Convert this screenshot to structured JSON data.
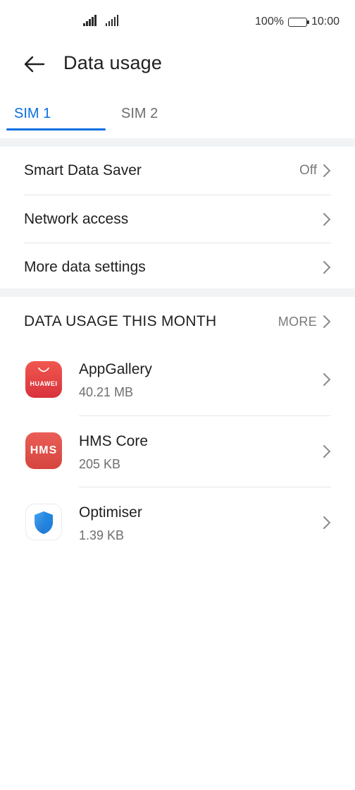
{
  "status_bar": {
    "battery_percent": "100%",
    "time": "10:00",
    "battery_level": 1.0
  },
  "header": {
    "title": "Data usage",
    "back_icon": "arrow-left-icon"
  },
  "tabs": [
    {
      "label": "SIM 1",
      "selected": true
    },
    {
      "label": "SIM 2",
      "selected": false
    }
  ],
  "settings": [
    {
      "label": "Smart Data Saver",
      "value": "Off"
    },
    {
      "label": "Network access",
      "value": ""
    },
    {
      "label": "More data settings",
      "value": ""
    }
  ],
  "section": {
    "title": "DATA USAGE THIS MONTH",
    "more_label": "MORE"
  },
  "apps": [
    {
      "name": "AppGallery",
      "usage": "40.21 MB",
      "icon": "appgallery-icon",
      "icon_text": "HUAWEI"
    },
    {
      "name": "HMS Core",
      "usage": "205 KB",
      "icon": "hms-core-icon",
      "icon_text": "HMS"
    },
    {
      "name": "Optimiser",
      "usage": "1.39 KB",
      "icon": "shield-icon",
      "icon_text": ""
    }
  ],
  "colors": {
    "accent": "#0a6fe0",
    "appgallery": "#e03f44",
    "hms": "#df4f49",
    "optimiser_shield": "#1e88e5"
  }
}
